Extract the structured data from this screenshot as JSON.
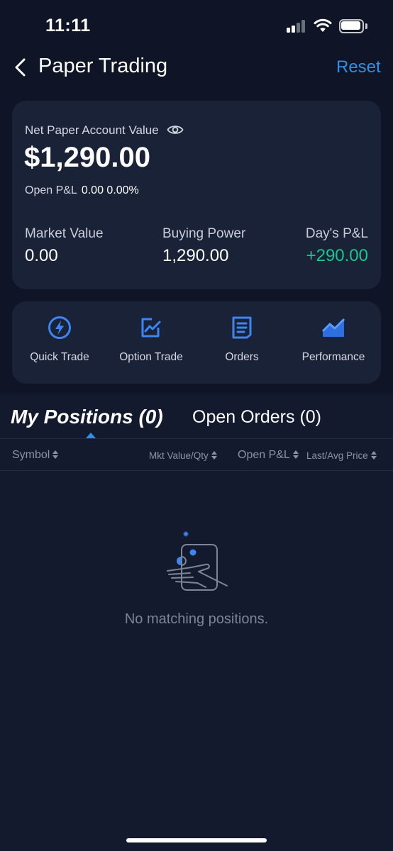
{
  "status_bar": {
    "time": "11:11"
  },
  "nav": {
    "title": "Paper Trading",
    "reset_label": "Reset"
  },
  "account": {
    "label": "Net Paper Account Value",
    "value": "$1,290.00",
    "open_pl_label": "Open P&L",
    "open_pl_value": "0.00 0.00%",
    "stats": [
      {
        "label": "Market Value",
        "value": "0.00"
      },
      {
        "label": "Buying Power",
        "value": "1,290.00"
      },
      {
        "label": "Day's P&L",
        "value": "+290.00"
      }
    ]
  },
  "actions": [
    {
      "label": "Quick Trade",
      "icon": "lightning-icon"
    },
    {
      "label": "Option Trade",
      "icon": "option-chart-icon"
    },
    {
      "label": "Orders",
      "icon": "orders-document-icon"
    },
    {
      "label": "Performance",
      "icon": "performance-chart-icon"
    }
  ],
  "tabs": {
    "positions": "My Positions (0)",
    "orders": "Open Orders (0)"
  },
  "columns": {
    "symbol": "Symbol",
    "mkt_value_qty": "Mkt Value/Qty",
    "open_pl": "Open P&L",
    "last_avg_price": "Last/Avg Price"
  },
  "empty_state": {
    "message": "No matching positions."
  },
  "colors": {
    "background": "#131a2e",
    "card": "#1a2238",
    "accent": "#2f8fe6",
    "positive": "#1fc38e"
  }
}
